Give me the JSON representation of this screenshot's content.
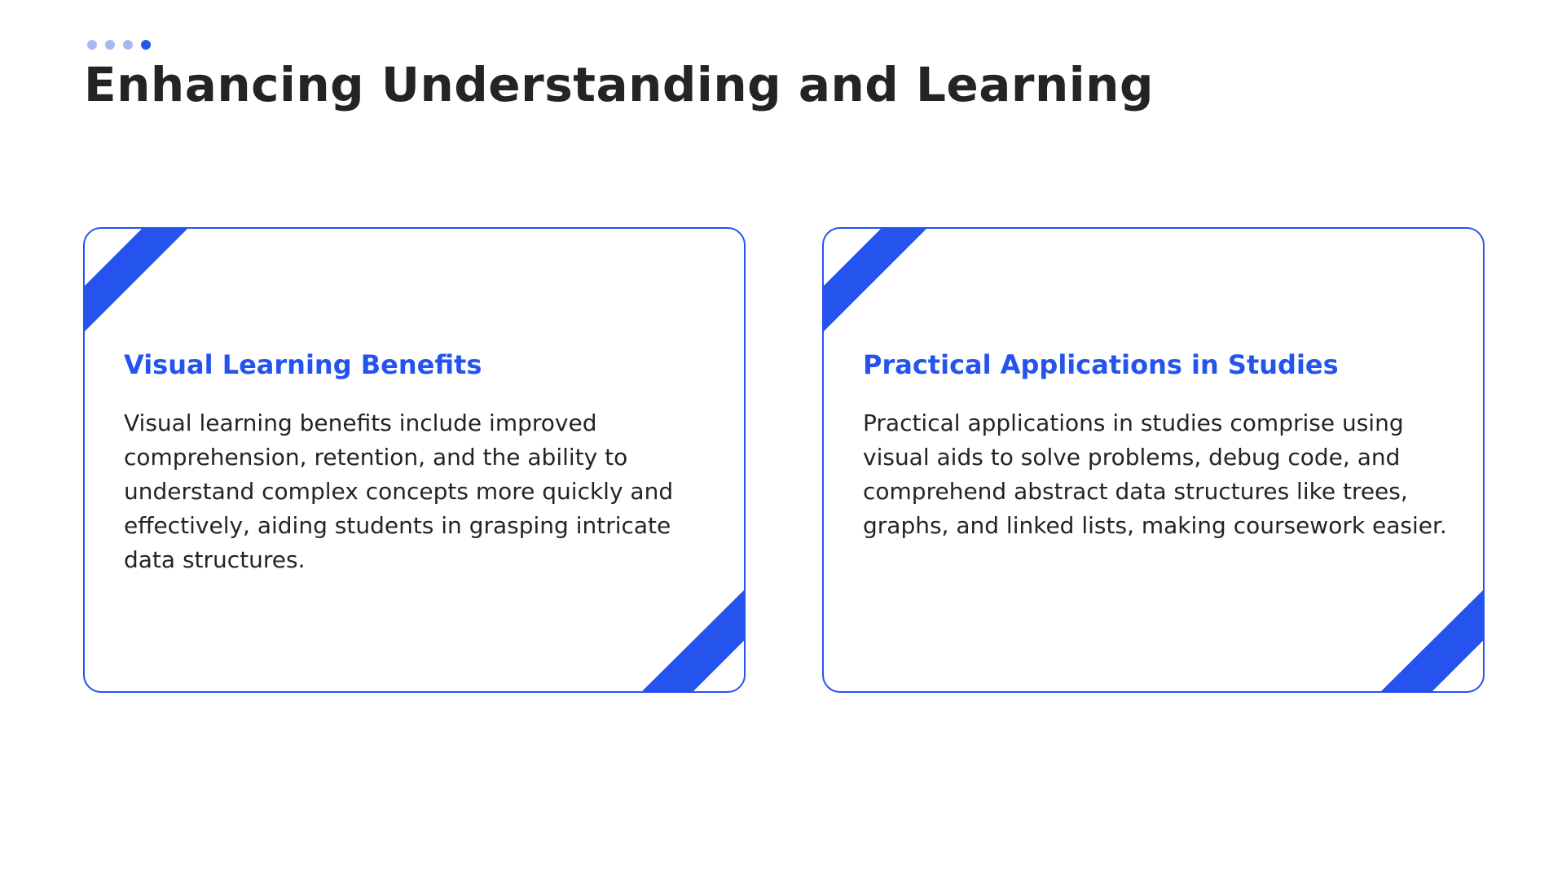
{
  "slide": {
    "title": "Enhancing Understanding and Learning",
    "progress": {
      "total": 4,
      "current": 4
    }
  },
  "cards": [
    {
      "title": "Visual Learning Benefits",
      "body": "Visual learning benefits include improved comprehension, retention, and the ability to understand complex concepts more quickly and effectively, aiding students in grasping intricate data structures."
    },
    {
      "title": "Practical Applications in Studies",
      "body": "Practical applications in studies comprise using visual aids to solve problems, debug code, and comprehend abstract data structures like trees, graphs, and linked lists, making coursework easier."
    }
  ],
  "colors": {
    "accent": "#2553ee",
    "accent_light": "#a9b8f5",
    "text": "#242424",
    "background": "#ffffff"
  }
}
